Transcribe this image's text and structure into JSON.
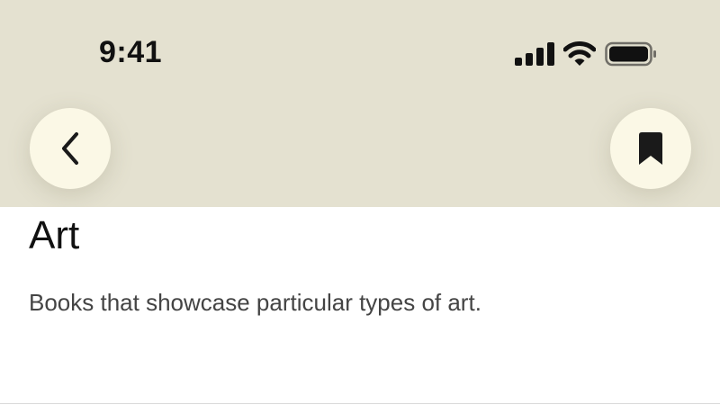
{
  "status_bar": {
    "time": "9:41",
    "icons": [
      "cellular-signal-icon",
      "wifi-icon",
      "battery-icon"
    ]
  },
  "navigation": {
    "back_icon": "chevron-left-icon",
    "bookmark_icon": "bookmark-icon"
  },
  "header_color": "#e4e1d0",
  "button_color": "#fbf8e6",
  "content": {
    "title": "Art",
    "description": "Books that showcase particular types of art."
  }
}
